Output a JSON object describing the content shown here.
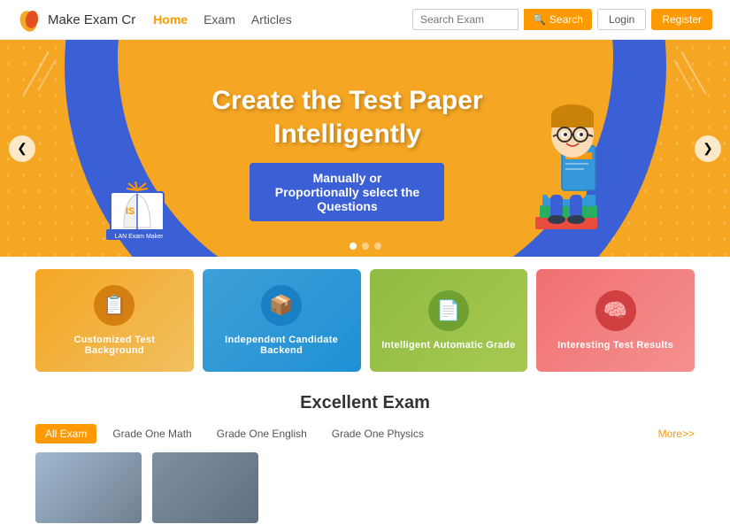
{
  "navbar": {
    "logo_text": "Make Exam Cr",
    "nav_items": [
      {
        "label": "Home",
        "active": true
      },
      {
        "label": "Exam",
        "active": false
      },
      {
        "label": "Articles",
        "active": false
      }
    ],
    "search_placeholder": "Search Exam",
    "search_btn": "Search",
    "login_btn": "Login",
    "register_btn": "Register"
  },
  "hero": {
    "title_line1": "Create the Test Paper",
    "title_line2": "Intelligently",
    "subtitle": "Manually or Proportionally select the Questions",
    "prev_icon": "❮",
    "next_icon": "❯"
  },
  "features": [
    {
      "label": "Customized Test Background",
      "color": "yellow",
      "icon": "📋"
    },
    {
      "label": "Independent Candidate Backend",
      "color": "blue",
      "icon": "📦"
    },
    {
      "label": "Intelligent Automatic Grade",
      "color": "green",
      "icon": "📄"
    },
    {
      "label": "Interesting Test Results",
      "color": "pink",
      "icon": "🧠"
    }
  ],
  "excellent_section": {
    "title": "Excellent Exam",
    "tabs": [
      {
        "label": "All Exam",
        "active": true
      },
      {
        "label": "Grade One Math",
        "active": false
      },
      {
        "label": "Grade One English",
        "active": false
      },
      {
        "label": "Grade One Physics",
        "active": false
      }
    ],
    "more_label": "More>>"
  }
}
